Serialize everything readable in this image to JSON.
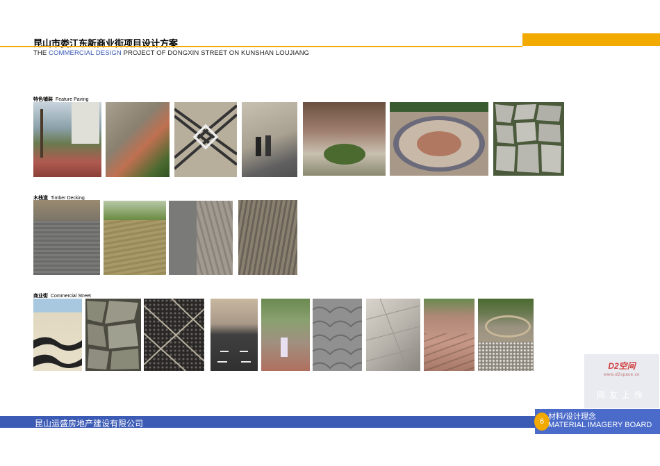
{
  "header": {
    "title_cn": "昆山市娄江东新商业街项目设计方案",
    "title_en_prefix": "THE ",
    "title_en_accent": "COMMERCIAL DESIGN",
    "title_en_suffix": " PROJECT OF DONGXIN STREET ON KUNSHAN LOUJIANG",
    "accent_color": "#f2a900",
    "blue_color": "#3b5bb5"
  },
  "sections": [
    {
      "label_cn": "特色铺装",
      "label_en": "Feature Paving"
    },
    {
      "label_cn": "木栈道",
      "label_en": "Timber Decking"
    },
    {
      "label_cn": "商业街",
      "label_en": "Commercial Street"
    }
  ],
  "footer": {
    "company": "昆山运盛房地产建设有限公司",
    "page_number": "6",
    "section_cn": "材料/设计理念",
    "section_en": "MATERIAL IMAGERY BOARD"
  },
  "watermark": {
    "logo": "D2空间",
    "url": "www.d2space.cn",
    "text": "网友上传"
  }
}
